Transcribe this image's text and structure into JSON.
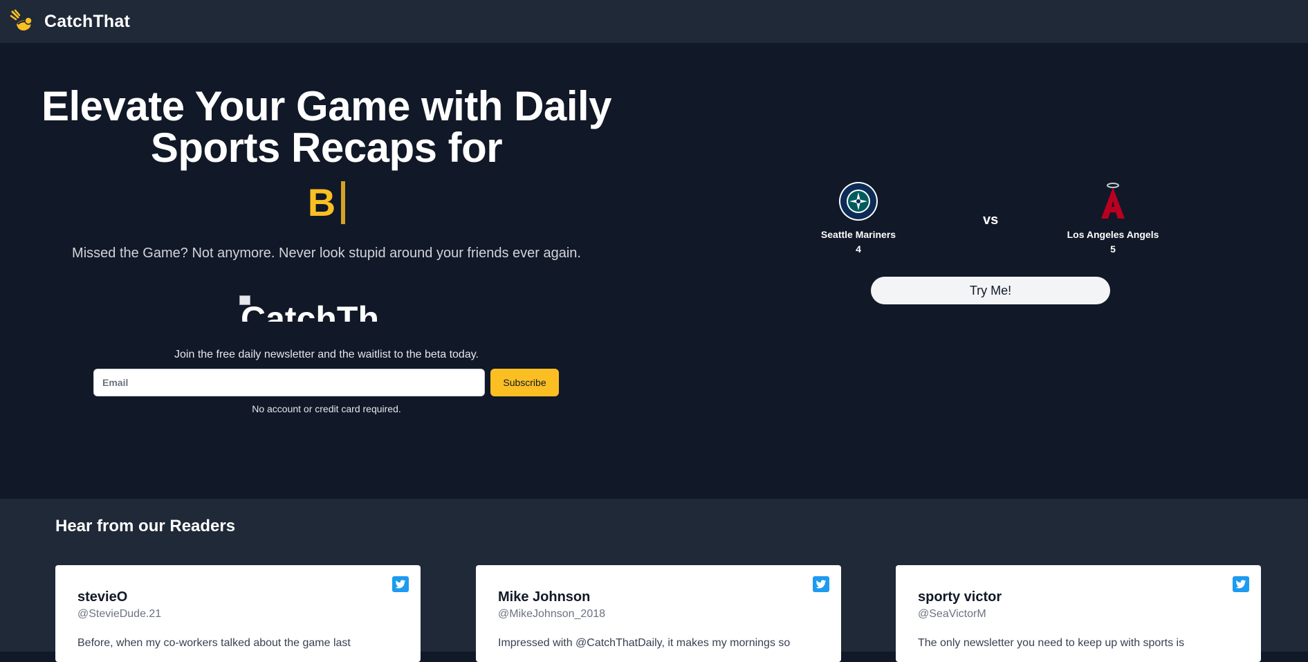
{
  "nav": {
    "brand": "CatchThat"
  },
  "hero": {
    "headline": "Elevate Your Game with Daily Sports Recaps for",
    "typed": "B",
    "tagline": "Missed the Game? Not anymore. Never look stupid around your friends ever again.",
    "logo_alt": "CatchTh",
    "newsletter_text": "Join the free daily newsletter and the waitlist to the beta today.",
    "email_placeholder": "Email",
    "subscribe_label": "Subscribe",
    "no_card_text": "No account or credit card required."
  },
  "scoreboard": {
    "home": {
      "name": "Seattle Mariners",
      "score": "4",
      "logo_icon": "mariners-logo-icon"
    },
    "away": {
      "name": "Los Angeles Angels",
      "score": "5",
      "logo_icon": "angels-logo-icon"
    },
    "vs_label": "vs",
    "try_label": "Try Me!"
  },
  "readers": {
    "title": "Hear from our Readers",
    "cards": [
      {
        "name": "stevieO",
        "handle": "@StevieDude.21",
        "text": "Before, when my co-workers talked about the game last"
      },
      {
        "name": "Mike Johnson",
        "handle": "@MikeJohnson_2018",
        "text": "Impressed with @CatchThatDaily, it makes my mornings so"
      },
      {
        "name": "sporty victor",
        "handle": "@SeaVictorM",
        "text": "The only newsletter you need to keep up with sports is"
      }
    ]
  },
  "colors": {
    "background": "#111827",
    "nav_bg": "#1f2937",
    "accent": "#fbbf24",
    "twitter": "#1d9bf0"
  }
}
